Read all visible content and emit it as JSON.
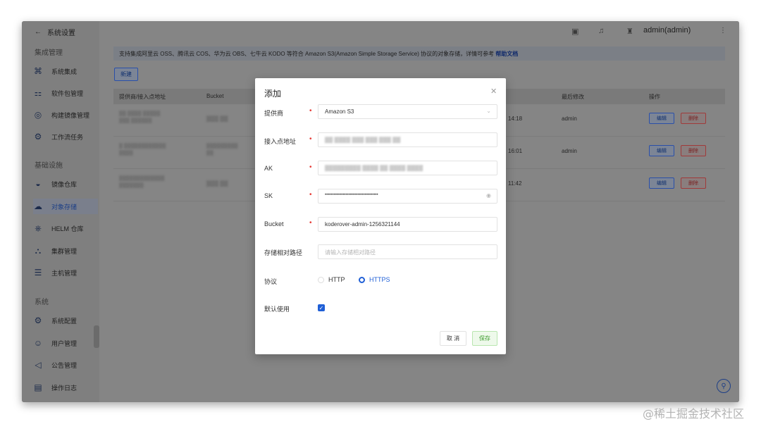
{
  "sidebar": {
    "back_label": "系统设置",
    "sections": [
      "集成管理",
      "基础设施",
      "系统"
    ],
    "items": [
      {
        "label": "系统集成",
        "icon": "puzzle-icon"
      },
      {
        "label": "软件包管理",
        "icon": "package-icon"
      },
      {
        "label": "构建镜像管理",
        "icon": "build-image-icon"
      },
      {
        "label": "工作流任务",
        "icon": "workflow-icon"
      },
      {
        "label": "镜像仓库",
        "icon": "registry-icon"
      },
      {
        "label": "对象存储",
        "icon": "cloud-icon"
      },
      {
        "label": "HELM 仓库",
        "icon": "helm-icon"
      },
      {
        "label": "集群管理",
        "icon": "cluster-icon"
      },
      {
        "label": "主机管理",
        "icon": "host-icon"
      },
      {
        "label": "系统配置",
        "icon": "gear-icon"
      },
      {
        "label": "用户管理",
        "icon": "user-icon"
      },
      {
        "label": "公告管理",
        "icon": "announcement-icon"
      },
      {
        "label": "操作日志",
        "icon": "log-icon"
      }
    ]
  },
  "topbar": {
    "user": "admin(admin)"
  },
  "notice": {
    "text": "支持集成阿里云 OSS、腾讯云 COS、华为云 OBS、七牛云 KODO 等符合 Amazon S3(Amazon Simple Storage Service) 协议的对象存储，详情可参考 ",
    "link": "帮助文档"
  },
  "new_button": "新建",
  "table": {
    "headers": [
      "提供商/接入点地址",
      "Bucket",
      "最后修改",
      "操作"
    ],
    "rows": [
      {
        "provider": "",
        "bucket": "",
        "time": "14:18",
        "modifier": "admin"
      },
      {
        "provider": "",
        "bucket": "",
        "time": "16:01",
        "modifier": "admin"
      },
      {
        "provider": "",
        "bucket": "",
        "time": "11:42",
        "modifier": ""
      }
    ],
    "edit_label": "编辑",
    "delete_label": "删除"
  },
  "modal": {
    "title": "添加",
    "fields": {
      "provider": {
        "label": "提供商",
        "value": "Amazon S3"
      },
      "endpoint": {
        "label": "接入点地址",
        "value": ""
      },
      "ak": {
        "label": "AK",
        "value": ""
      },
      "sk": {
        "label": "SK",
        "value": "••••••••••••••••••••••••••••••••••••"
      },
      "bucket": {
        "label": "Bucket",
        "value": "koderover-admin-1256321144"
      },
      "path": {
        "label": "存储相对路径",
        "placeholder": "请输入存储相对路径"
      },
      "protocol": {
        "label": "协议",
        "options": [
          "HTTP",
          "HTTPS"
        ],
        "selected": "HTTPS"
      },
      "default": {
        "label": "默认使用",
        "checked": true
      }
    },
    "cancel_label": "取 消",
    "save_label": "保存"
  },
  "watermark": "@稀土掘金技术社区"
}
